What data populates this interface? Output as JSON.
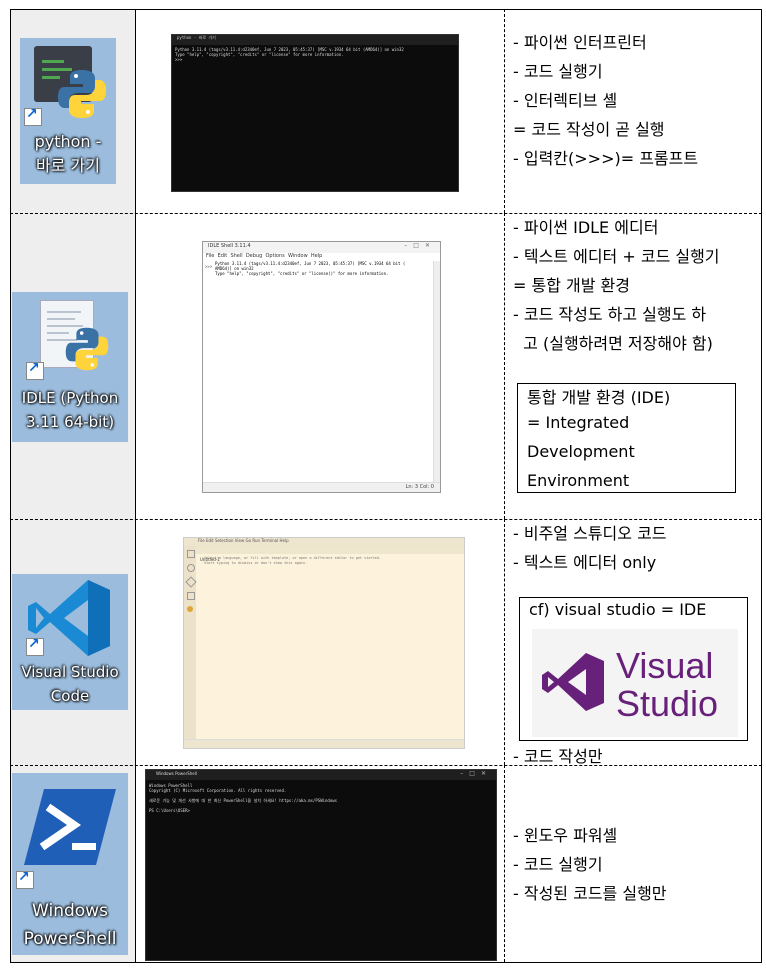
{
  "rows": [
    {
      "icon": {
        "label_line1": "python -",
        "label_line2": "바로 가기"
      },
      "screenshot": {
        "title": "python - 바로 가기",
        "lines": [
          "Python 3.11.4 (tags/v3.11.4:d2340ef, Jun  7 2023, 05:45:37) [MSC v.1934 64 bit (AMD64)] on win32",
          "Type \"help\", \"copyright\", \"credits\" or \"license\" for more information.",
          ">>>"
        ]
      },
      "notes": [
        "- 파이썬 인터프린터",
        "- 코드 실행기",
        "- 인터렉티브 셸",
        "= 코드 작성이 곧 실행",
        "- 입력칸(>>>)= 프롬프트"
      ]
    },
    {
      "icon": {
        "label_line1": "IDLE (Python",
        "label_line2": "3.11 64-bit)"
      },
      "screenshot": {
        "title": "IDLE Shell 3.11.4",
        "menu": [
          "File",
          "Edit",
          "Shell",
          "Debug",
          "Options",
          "Window",
          "Help"
        ],
        "lines": [
          "Python 3.11.4 (tags/v3.11.4:d2340ef, Jun  7 2023, 05:45:37) [MSC v.1934 64 bit (",
          "AMD64)] on win32",
          "Type \"help\", \"copyright\", \"credits\" or \"license()\" for more information."
        ],
        "prompt": ">>>",
        "status": "Ln: 3  Col: 0"
      },
      "notes": [
        "- 파이썬 IDLE 에디터",
        "- 텍스트 에디터 + 코드 실행기",
        "= 통합 개발 환경",
        "- 코드 작성도 하고 실행도 하",
        "  고 (실행하려면 저장해야 함)"
      ],
      "box": [
        "통합 개발 환경 (IDE)",
        "= Integrated",
        "Development",
        "Environment"
      ]
    },
    {
      "icon": {
        "label_line1": "Visual Studio",
        "label_line2": "Code"
      },
      "screenshot": {
        "menu": [
          "File",
          "Edit",
          "Selection",
          "View",
          "Go",
          "Run",
          "Terminal",
          "Help"
        ],
        "tab": "Untitled-1",
        "line1": "Select a language, or fill with template, or open a different editor to get started.",
        "line2": "Start typing to dismiss or don't show this again."
      },
      "notes": [
        "- 비주얼 스튜디오 코드",
        "- 텍스트 에디터 only"
      ],
      "box": {
        "caption": "cf) visual studio = IDE",
        "logo_line1": "Visual",
        "logo_line2": "Studio"
      },
      "footer_note": "- 코드 작성만"
    },
    {
      "icon": {
        "label_line1": "Windows",
        "label_line2": "PowerShell"
      },
      "screenshot": {
        "title": "Windows PowerShell",
        "lines": [
          "Windows PowerShell",
          "Copyright (C) Microsoft Corporation. All rights reserved.",
          "",
          "새로운 기능 및 개선 사항에 대 한 최신 PowerShell을 설치 하세요! https://aka.ms/PSWindows",
          "",
          "PS C:\\Users\\USER> "
        ]
      },
      "notes": [
        "- 윈도우 파워셸",
        "- 코드 실행기",
        "- 작성된 코드를 실행만"
      ]
    }
  ],
  "colors": {
    "tile": "#9bbcdc",
    "python_blue": "#3a72a6",
    "python_yellow": "#ffd43b",
    "vs_purple": "#68217a",
    "ps_blue": "#1f5fb8"
  }
}
